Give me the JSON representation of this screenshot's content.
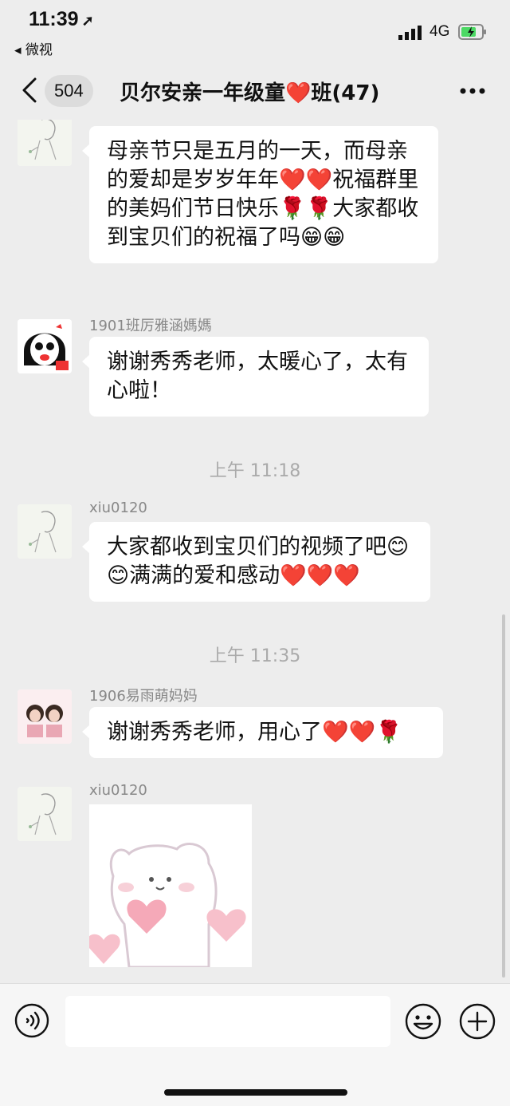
{
  "status": {
    "time": "11:39",
    "location_glyph": "➚",
    "back_app": "◂ 微视",
    "network": "4G"
  },
  "nav": {
    "unread_count": "504",
    "title": "贝尔安亲一年级童❤️班(47)"
  },
  "messages": [
    {
      "sender": "",
      "text": "母亲节只是五月的一天，而母亲的爱却是岁岁年年❤️❤️祝福群里的美妈们节日快乐🌹🌹大家都收到宝贝们的祝福了吗😁😁"
    },
    {
      "sender": "1901班厉雅涵媽媽",
      "text": "谢谢秀秀老师，太暖心了，太有心啦！"
    },
    {
      "sender": "xiu0120",
      "text": "大家都收到宝贝们的视频了吧😊😊满满的爱和感动❤️❤️❤️"
    },
    {
      "sender": "1906易雨萌妈妈",
      "text": "谢谢秀秀老师，用心了❤️❤️🌹"
    },
    {
      "sender": "xiu0120",
      "text": ""
    }
  ],
  "timestamps": [
    "上午 11:18",
    "上午 11:35"
  ],
  "colors": {
    "heart": "#e8552c",
    "rose": "#d63a3a",
    "bg": "#ededed"
  }
}
